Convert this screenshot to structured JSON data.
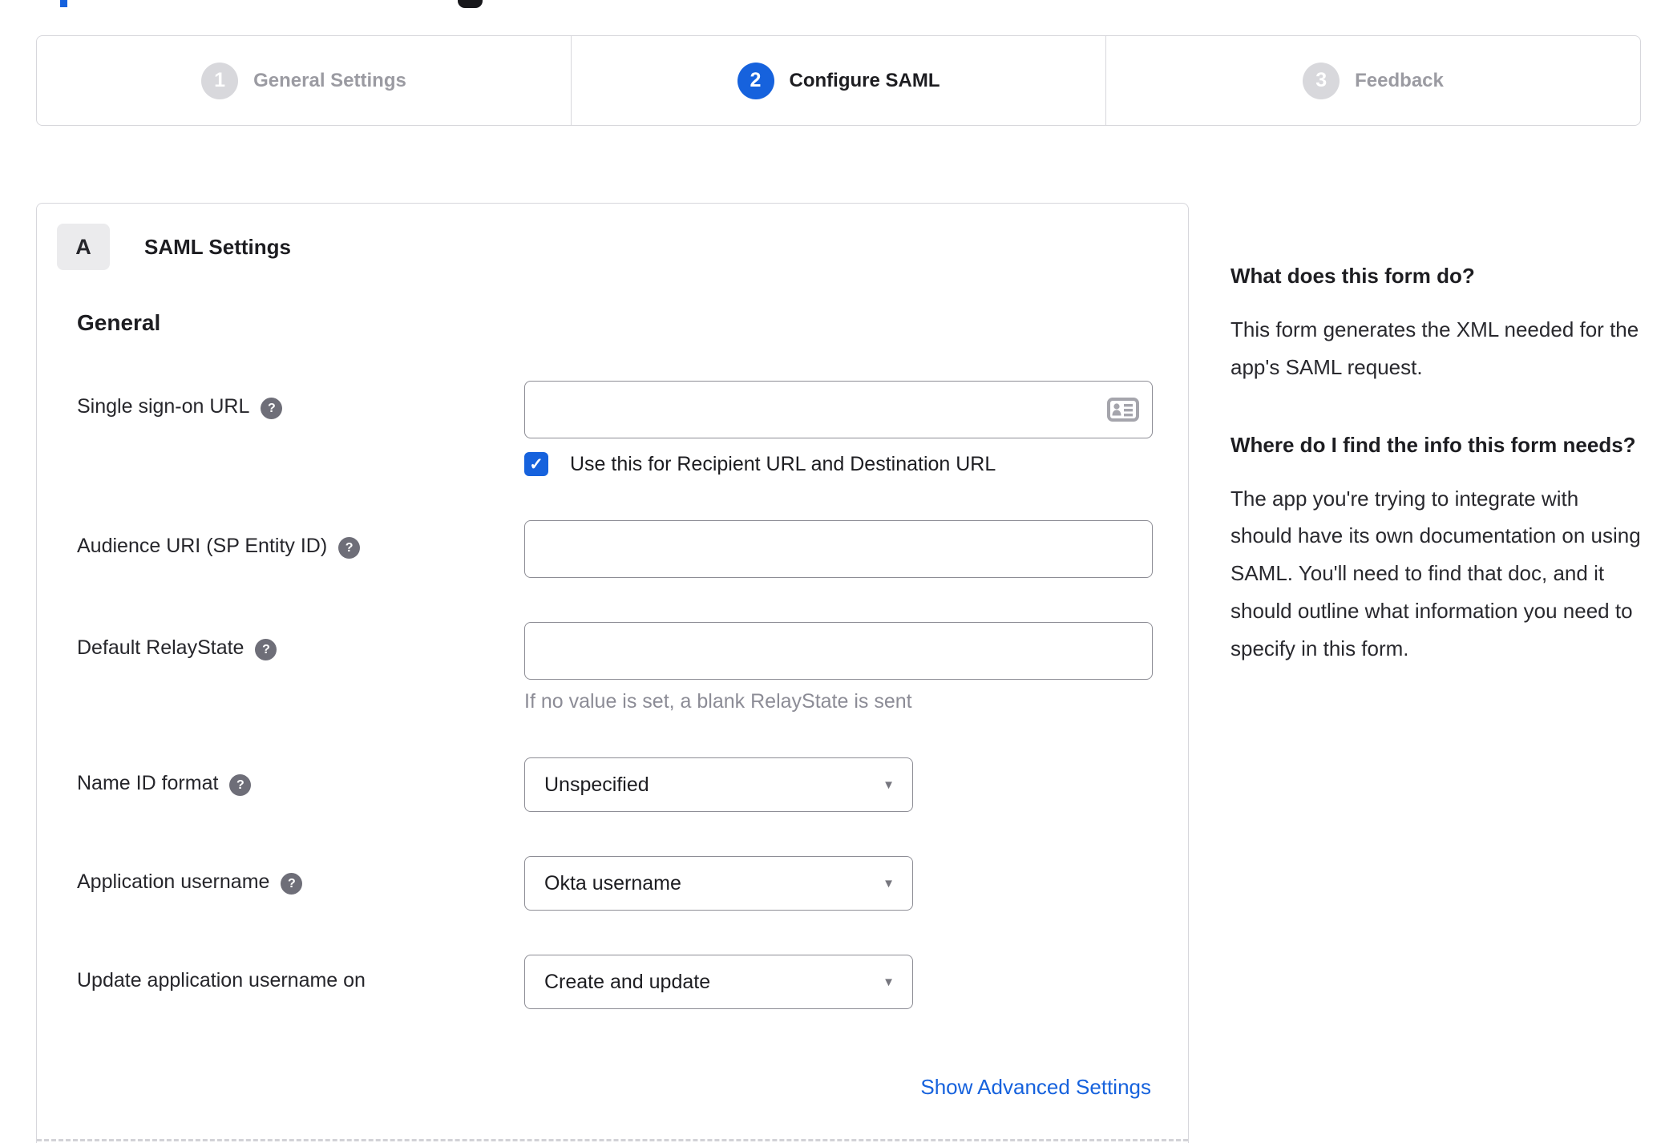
{
  "icons": {
    "help": "?",
    "check": "✓",
    "dropdown_arrow": "▼"
  },
  "colors": {
    "accent_blue": "#1662dd",
    "inactive_step_gray": "#d8d8dc",
    "border_light": "#d7d7dc",
    "border_input": "#8d8d95",
    "hint_gray": "#8c8c96"
  },
  "stepper": {
    "steps": [
      {
        "number": "1",
        "label": "General Settings",
        "state": "inactive"
      },
      {
        "number": "2",
        "label": "Configure SAML",
        "state": "active"
      },
      {
        "number": "3",
        "label": "Feedback",
        "state": "inactive"
      }
    ]
  },
  "panel": {
    "section_badge": "A",
    "section_title": "SAML Settings",
    "group_title": "General",
    "fields": [
      {
        "label": "Single sign-on URL",
        "type": "text",
        "value": "",
        "checkbox_checked": true,
        "checkbox_label": "Use this for Recipient URL and Destination URL"
      },
      {
        "label": "Audience URI (SP Entity ID)",
        "type": "text",
        "value": ""
      },
      {
        "label": "Default RelayState",
        "type": "text",
        "value": "",
        "hint": "If no value is set, a blank RelayState is sent"
      },
      {
        "label": "Name ID format",
        "type": "select",
        "value": "Unspecified"
      },
      {
        "label": "Application username",
        "type": "select",
        "value": "Okta username"
      },
      {
        "label": "Update application username on",
        "type": "select",
        "value": "Create and update"
      }
    ],
    "advanced_link": "Show Advanced Settings"
  },
  "sidebar": {
    "sections": [
      {
        "heading": "What does this form do?",
        "body": "This form generates the XML needed for the app's SAML request."
      },
      {
        "heading": "Where do I find the info this form needs?",
        "body": "The app you're trying to integrate with should have its own documentation on using SAML. You'll need to find that doc, and it should outline what information you need to specify in this form."
      }
    ]
  }
}
